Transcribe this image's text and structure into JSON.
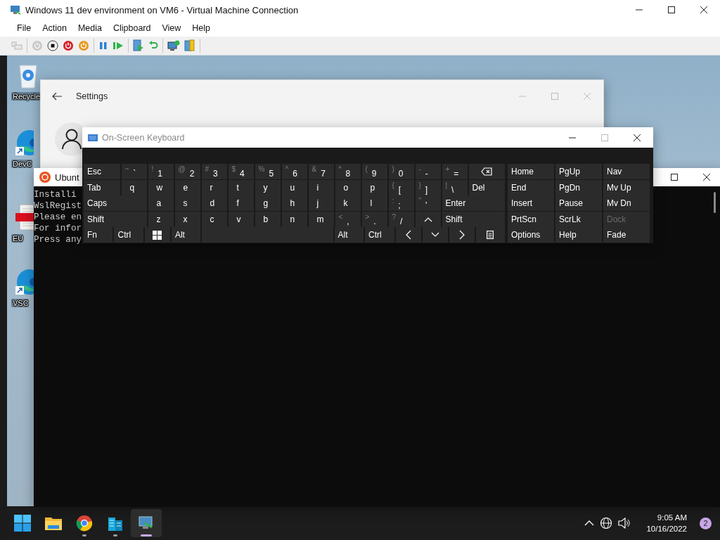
{
  "host_window": {
    "title": "Windows 11 dev environment on VM6 - Virtual Machine Connection",
    "buttons": [
      {
        "kind": "minimize",
        "disabled": false
      },
      {
        "kind": "maximize",
        "disabled": false
      },
      {
        "kind": "close",
        "disabled": false
      }
    ]
  },
  "menu": [
    "File",
    "Action",
    "Media",
    "Clipboard",
    "View",
    "Help"
  ],
  "toolbar": [
    [
      {
        "kind": "ctrlaltdel",
        "disabled": true
      }
    ],
    [
      {
        "kind": "start",
        "disabled": true
      },
      {
        "kind": "turnoff",
        "disabled": false
      },
      {
        "kind": "shutdown",
        "disabled": false
      },
      {
        "kind": "save",
        "disabled": false
      }
    ],
    [
      {
        "kind": "pause",
        "disabled": false
      },
      {
        "kind": "resume",
        "disabled": false
      }
    ],
    [
      {
        "kind": "checkpoint",
        "disabled": false
      },
      {
        "kind": "revert",
        "disabled": false
      }
    ],
    [
      {
        "kind": "enhanced",
        "disabled": false
      },
      {
        "kind": "share",
        "disabled": false
      }
    ]
  ],
  "desktop_icons": [
    {
      "kind": "recycle",
      "label": "Recycle"
    },
    {
      "kind": "edge",
      "label": "DevC"
    },
    {
      "kind": "pdf",
      "label": "EU"
    },
    {
      "kind": "edge",
      "label": "VSC"
    }
  ],
  "settings_window": {
    "title": "Settings",
    "buttons": [
      {
        "kind": "minimize",
        "disabled": true
      },
      {
        "kind": "maximize",
        "disabled": true
      },
      {
        "kind": "close",
        "disabled": true
      }
    ]
  },
  "ubuntu_window": {
    "title": "Ubunt",
    "buttons": [
      {
        "kind": "maximize",
        "disabled": false
      },
      {
        "kind": "close",
        "disabled": false
      }
    ],
    "lines": [
      "Installi",
      "WslRegist",
      "Please en",
      "For infor",
      "Press any"
    ]
  },
  "osk": {
    "title": "On-Screen Keyboard",
    "buttons": [
      {
        "kind": "minimize",
        "disabled": false
      },
      {
        "kind": "maximize",
        "disabled": true
      },
      {
        "kind": "close",
        "disabled": false
      }
    ],
    "rows": [
      {
        "keys": [
          {
            "kind": "mod",
            "label": "Esc"
          },
          {
            "kind": "dual",
            "shift": "~",
            "label": "`"
          },
          {
            "kind": "dual",
            "shift": "!",
            "label": "1"
          },
          {
            "kind": "dual",
            "shift": "@",
            "label": "2"
          },
          {
            "kind": "dual",
            "shift": "#",
            "label": "3"
          },
          {
            "kind": "dual",
            "shift": "$",
            "label": "4"
          },
          {
            "kind": "dual",
            "shift": "%",
            "label": "5"
          },
          {
            "kind": "dual",
            "shift": "^",
            "label": "6"
          },
          {
            "kind": "dual",
            "shift": "&",
            "label": "7"
          },
          {
            "kind": "dual",
            "shift": "*",
            "label": "8"
          },
          {
            "kind": "dual",
            "shift": "(",
            "label": "9"
          },
          {
            "kind": "dual",
            "shift": ")",
            "label": "0"
          },
          {
            "kind": "dual",
            "shift": "-",
            "label": "-"
          },
          {
            "kind": "dual",
            "shift": "+",
            "label": "="
          },
          {
            "kind": "backspace"
          }
        ]
      },
      {
        "keys": [
          {
            "kind": "mod",
            "label": "Tab"
          },
          {
            "kind": "letter",
            "label": "q"
          },
          {
            "kind": "letter",
            "label": "w"
          },
          {
            "kind": "letter",
            "label": "e"
          },
          {
            "kind": "letter",
            "label": "r"
          },
          {
            "kind": "letter",
            "label": "t"
          },
          {
            "kind": "letter",
            "label": "y"
          },
          {
            "kind": "letter",
            "label": "u"
          },
          {
            "kind": "letter",
            "label": "i"
          },
          {
            "kind": "letter",
            "label": "o"
          },
          {
            "kind": "letter",
            "label": "p"
          },
          {
            "kind": "dual",
            "shift": "{",
            "label": "["
          },
          {
            "kind": "dual",
            "shift": "}",
            "label": "]"
          },
          {
            "kind": "dual",
            "shift": "|",
            "label": "\\"
          },
          {
            "kind": "mod",
            "label": "Del"
          }
        ]
      },
      {
        "keys": [
          {
            "kind": "mod",
            "label": "Caps"
          },
          {
            "kind": "letter",
            "label": "a"
          },
          {
            "kind": "letter",
            "label": "s"
          },
          {
            "kind": "letter",
            "label": "d"
          },
          {
            "kind": "letter",
            "label": "f"
          },
          {
            "kind": "letter",
            "label": "g"
          },
          {
            "kind": "letter",
            "label": "h"
          },
          {
            "kind": "letter",
            "label": "j"
          },
          {
            "kind": "letter",
            "label": "k"
          },
          {
            "kind": "letter",
            "label": "l"
          },
          {
            "kind": "dual",
            "shift": ":",
            "label": ";"
          },
          {
            "kind": "dual",
            "shift": "\"",
            "label": "'"
          },
          {
            "kind": "mod",
            "label": "Enter"
          }
        ]
      },
      {
        "keys": [
          {
            "kind": "mod",
            "label": "Shift"
          },
          {
            "kind": "letter",
            "label": "z"
          },
          {
            "kind": "letter",
            "label": "x"
          },
          {
            "kind": "letter",
            "label": "c"
          },
          {
            "kind": "letter",
            "label": "v"
          },
          {
            "kind": "letter",
            "label": "b"
          },
          {
            "kind": "letter",
            "label": "n"
          },
          {
            "kind": "letter",
            "label": "m"
          },
          {
            "kind": "dual",
            "shift": "<",
            "label": ","
          },
          {
            "kind": "dual",
            "shift": ">",
            "label": "."
          },
          {
            "kind": "dual",
            "shift": "?",
            "label": "/"
          },
          {
            "kind": "up"
          },
          {
            "kind": "mod",
            "label": "Shift"
          }
        ]
      },
      {
        "keys": [
          {
            "kind": "mod",
            "label": "Fn"
          },
          {
            "kind": "mod",
            "label": "Ctrl"
          },
          {
            "kind": "windows"
          },
          {
            "kind": "mod",
            "label": "Alt"
          },
          {
            "kind": "space"
          },
          {
            "kind": "mod",
            "label": "Alt"
          },
          {
            "kind": "mod",
            "label": "Ctrl"
          },
          {
            "kind": "left"
          },
          {
            "kind": "down"
          },
          {
            "kind": "right"
          },
          {
            "kind": "menu"
          }
        ]
      }
    ],
    "nav_keys": [
      {
        "label": "Home",
        "disabled": false
      },
      {
        "label": "PgUp",
        "disabled": false
      },
      {
        "label": "Nav",
        "disabled": false
      },
      {
        "label": "End",
        "disabled": false
      },
      {
        "label": "PgDn",
        "disabled": false
      },
      {
        "label": "Mv Up",
        "disabled": false
      },
      {
        "label": "Insert",
        "disabled": false
      },
      {
        "label": "Pause",
        "disabled": false
      },
      {
        "label": "Mv Dn",
        "disabled": false
      },
      {
        "label": "PrtScn",
        "disabled": false
      },
      {
        "label": "ScrLk",
        "disabled": false
      },
      {
        "label": "Dock",
        "disabled": true
      },
      {
        "label": "Options",
        "disabled": false
      },
      {
        "label": "Help",
        "disabled": false
      },
      {
        "label": "Fade",
        "disabled": false
      }
    ]
  },
  "taskbar": {
    "items": [
      {
        "kind": "start",
        "running": false,
        "selected": false
      },
      {
        "kind": "explorer",
        "running": false,
        "selected": false
      },
      {
        "kind": "browser",
        "running": true,
        "selected": false
      },
      {
        "kind": "buildings",
        "running": true,
        "selected": false
      },
      {
        "kind": "hyperv",
        "running": true,
        "selected": true
      }
    ],
    "time": "9:05 AM",
    "date": "10/16/2022",
    "notifications": "2"
  }
}
